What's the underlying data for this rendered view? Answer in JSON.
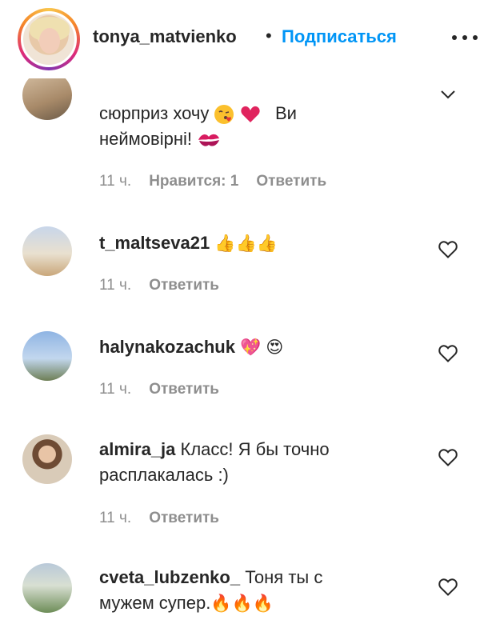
{
  "header": {
    "username": "tonya_matvienko",
    "separator": "•",
    "follow_label": "Подписаться"
  },
  "comments": [
    {
      "text_line1": "сюрприз хочу",
      "text_line2": "Ви",
      "text_line3": "неймовірні!",
      "time": "11 ч.",
      "likes": "Нравится: 1",
      "reply": "Ответить"
    },
    {
      "username": "t_maltseva21",
      "text": "",
      "time": "11 ч.",
      "reply": "Ответить"
    },
    {
      "username": "halynakozachuk",
      "text": "",
      "time": "11 ч.",
      "reply": "Ответить"
    },
    {
      "username": "almira_ja",
      "text": "Класс! Я бы точно",
      "text_line2": "расплакалась :)",
      "time": "11 ч.",
      "reply": "Ответить"
    },
    {
      "username": "cveta_lubzenko_",
      "text": "Тоня ты с",
      "text_line2": "мужем супер."
    }
  ],
  "icons": {
    "more": "more-options-icon",
    "heart": "heart-outline-icon",
    "chevron": "chevron-down-icon"
  }
}
